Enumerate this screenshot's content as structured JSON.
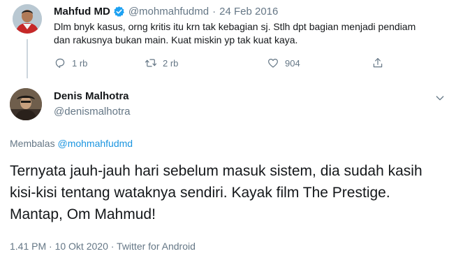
{
  "parent_tweet": {
    "name": "Mahfud MD",
    "handle": "@mohmahfudmd",
    "separator": "·",
    "date": "24 Feb 2016",
    "text": "Dlm bnyk kasus, orng kritis itu krn tak kebagian sj. Stlh dpt bagian menjadi pendiam dan rakusnya bukan main. Kuat miskin yp tak kuat kaya.",
    "actions": {
      "reply_count": "1 rb",
      "retweet_count": "2 rb",
      "like_count": "904"
    }
  },
  "reply_tweet": {
    "name": "Denis Malhotra",
    "handle": "@denismalhotra",
    "replying_prefix": "Membalas",
    "replying_to": "@mohmahfudmd",
    "text": "Ternyata jauh-jauh hari sebelum masuk sistem, dia sudah kasih kisi-kisi tentang wataknya sendiri. Kayak film The Prestige. Mantap, Om Mahmud!",
    "meta": "1.41 PM · 10 Okt 2020 · Twitter for Android"
  },
  "icons": {
    "verified": "verified-badge-icon",
    "reply": "reply-icon",
    "retweet": "retweet-icon",
    "like": "heart-icon",
    "share": "share-icon",
    "more": "chevron-down-icon"
  },
  "colors": {
    "primary_text": "#14171a",
    "secondary_text": "#657786",
    "link": "#1b95e0",
    "verified": "#1da1f2",
    "thread_line": "#ccd6dd"
  }
}
